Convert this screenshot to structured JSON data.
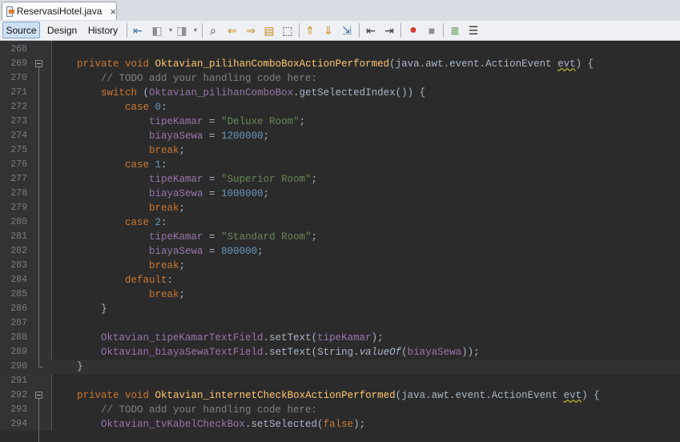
{
  "tab": {
    "title": "ReservasiHotel.java",
    "close": "×"
  },
  "toolbar": {
    "views": [
      "Source",
      "Design",
      "History"
    ],
    "active": "Source"
  },
  "lines": [
    {
      "n": "268",
      "parts": [
        {
          "t": "",
          "c": ""
        }
      ]
    },
    {
      "n": "269",
      "fold": "open",
      "parts": [
        {
          "t": "    ",
          "c": ""
        },
        {
          "t": "private void ",
          "c": "kw"
        },
        {
          "t": "Oktavian_pilihanComboBoxActionPerformed",
          "c": "fn"
        },
        {
          "t": "(java.awt.event.ActionEvent ",
          "c": ""
        },
        {
          "t": "evt",
          "c": "warn"
        },
        {
          "t": ") {",
          "c": ""
        }
      ]
    },
    {
      "n": "270",
      "parts": [
        {
          "t": "        // TODO add your handling code here:",
          "c": "cmt"
        }
      ]
    },
    {
      "n": "271",
      "parts": [
        {
          "t": "        ",
          "c": ""
        },
        {
          "t": "switch ",
          "c": "kw"
        },
        {
          "t": "(",
          "c": ""
        },
        {
          "t": "Oktavian_pilihanComboBox",
          "c": "fld"
        },
        {
          "t": ".getSelectedIndex()) {",
          "c": ""
        }
      ]
    },
    {
      "n": "272",
      "parts": [
        {
          "t": "            ",
          "c": ""
        },
        {
          "t": "case ",
          "c": "kw"
        },
        {
          "t": "0",
          "c": "num"
        },
        {
          "t": ":",
          "c": ""
        }
      ]
    },
    {
      "n": "273",
      "parts": [
        {
          "t": "                ",
          "c": ""
        },
        {
          "t": "tipeKamar",
          "c": "fld"
        },
        {
          "t": " = ",
          "c": ""
        },
        {
          "t": "\"Deluxe Room\"",
          "c": "str"
        },
        {
          "t": ";",
          "c": ""
        }
      ]
    },
    {
      "n": "274",
      "parts": [
        {
          "t": "                ",
          "c": ""
        },
        {
          "t": "biayaSewa",
          "c": "fld"
        },
        {
          "t": " = ",
          "c": ""
        },
        {
          "t": "1200000",
          "c": "num"
        },
        {
          "t": ";",
          "c": ""
        }
      ]
    },
    {
      "n": "275",
      "parts": [
        {
          "t": "                ",
          "c": ""
        },
        {
          "t": "break",
          "c": "kw"
        },
        {
          "t": ";",
          "c": ""
        }
      ]
    },
    {
      "n": "276",
      "parts": [
        {
          "t": "            ",
          "c": ""
        },
        {
          "t": "case ",
          "c": "kw"
        },
        {
          "t": "1",
          "c": "num"
        },
        {
          "t": ":",
          "c": ""
        }
      ]
    },
    {
      "n": "277",
      "parts": [
        {
          "t": "                ",
          "c": ""
        },
        {
          "t": "tipeKamar",
          "c": "fld"
        },
        {
          "t": " = ",
          "c": ""
        },
        {
          "t": "\"Superior Room\"",
          "c": "str"
        },
        {
          "t": ";",
          "c": ""
        }
      ]
    },
    {
      "n": "278",
      "parts": [
        {
          "t": "                ",
          "c": ""
        },
        {
          "t": "biayaSewa",
          "c": "fld"
        },
        {
          "t": " = ",
          "c": ""
        },
        {
          "t": "1000000",
          "c": "num"
        },
        {
          "t": ";",
          "c": ""
        }
      ]
    },
    {
      "n": "279",
      "parts": [
        {
          "t": "                ",
          "c": ""
        },
        {
          "t": "break",
          "c": "kw"
        },
        {
          "t": ";",
          "c": ""
        }
      ]
    },
    {
      "n": "280",
      "parts": [
        {
          "t": "            ",
          "c": ""
        },
        {
          "t": "case ",
          "c": "kw"
        },
        {
          "t": "2",
          "c": "num"
        },
        {
          "t": ":",
          "c": ""
        }
      ]
    },
    {
      "n": "281",
      "parts": [
        {
          "t": "                ",
          "c": ""
        },
        {
          "t": "tipeKamar",
          "c": "fld"
        },
        {
          "t": " = ",
          "c": ""
        },
        {
          "t": "\"Standard Room\"",
          "c": "str"
        },
        {
          "t": ";",
          "c": ""
        }
      ]
    },
    {
      "n": "282",
      "parts": [
        {
          "t": "                ",
          "c": ""
        },
        {
          "t": "biayaSewa",
          "c": "fld"
        },
        {
          "t": " = ",
          "c": ""
        },
        {
          "t": "800000",
          "c": "num"
        },
        {
          "t": ";",
          "c": ""
        }
      ]
    },
    {
      "n": "283",
      "parts": [
        {
          "t": "                ",
          "c": ""
        },
        {
          "t": "break",
          "c": "kw"
        },
        {
          "t": ";",
          "c": ""
        }
      ]
    },
    {
      "n": "284",
      "parts": [
        {
          "t": "            ",
          "c": ""
        },
        {
          "t": "default",
          "c": "kw"
        },
        {
          "t": ":",
          "c": ""
        }
      ]
    },
    {
      "n": "285",
      "parts": [
        {
          "t": "                ",
          "c": ""
        },
        {
          "t": "break",
          "c": "kw"
        },
        {
          "t": ";",
          "c": ""
        }
      ]
    },
    {
      "n": "286",
      "parts": [
        {
          "t": "        }",
          "c": ""
        }
      ]
    },
    {
      "n": "287",
      "parts": [
        {
          "t": "",
          "c": ""
        }
      ]
    },
    {
      "n": "288",
      "parts": [
        {
          "t": "        ",
          "c": ""
        },
        {
          "t": "Oktavian_tipeKamarTextField",
          "c": "fld"
        },
        {
          "t": ".setText(",
          "c": ""
        },
        {
          "t": "tipeKamar",
          "c": "fld"
        },
        {
          "t": ");",
          "c": ""
        }
      ]
    },
    {
      "n": "289",
      "parts": [
        {
          "t": "        ",
          "c": ""
        },
        {
          "t": "Oktavian_biayaSewaTextField",
          "c": "fld"
        },
        {
          "t": ".setText(String.",
          "c": ""
        },
        {
          "t": "valueOf",
          "c": "italic"
        },
        {
          "t": "(",
          "c": ""
        },
        {
          "t": "biayaSewa",
          "c": "fld"
        },
        {
          "t": "));",
          "c": ""
        }
      ]
    },
    {
      "n": "290",
      "fold": "end",
      "highlight": true,
      "parts": [
        {
          "t": "    }",
          "c": ""
        }
      ]
    },
    {
      "n": "291",
      "parts": [
        {
          "t": "",
          "c": ""
        }
      ]
    },
    {
      "n": "292",
      "fold": "open",
      "parts": [
        {
          "t": "    ",
          "c": ""
        },
        {
          "t": "private void ",
          "c": "kw"
        },
        {
          "t": "Oktavian_internetCheckBoxActionPerformed",
          "c": "fn"
        },
        {
          "t": "(java.awt.event.ActionEvent ",
          "c": ""
        },
        {
          "t": "evt",
          "c": "warn"
        },
        {
          "t": ") {",
          "c": ""
        }
      ]
    },
    {
      "n": "293",
      "parts": [
        {
          "t": "        // TODO add your handling code here:",
          "c": "cmt"
        }
      ]
    },
    {
      "n": "294",
      "parts": [
        {
          "t": "        ",
          "c": ""
        },
        {
          "t": "Oktavian_tvKabelCheckBox",
          "c": "fld"
        },
        {
          "t": ".setSelected(",
          "c": ""
        },
        {
          "t": "false",
          "c": "kw"
        },
        {
          "t": ");",
          "c": ""
        }
      ]
    }
  ]
}
